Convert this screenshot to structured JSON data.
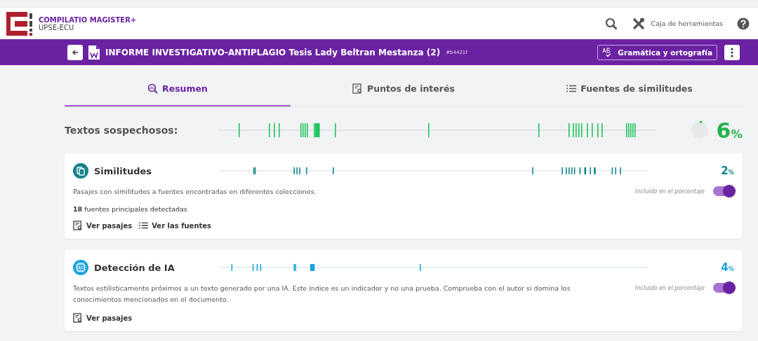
{
  "brand": {
    "name": "COMPILATIO MAGISTER+",
    "org": "UPSE-ECU"
  },
  "toolbar": {
    "tools_label": "Caja de herramientas"
  },
  "document": {
    "title": "INFORME INVESTIGATIVO-ANTIPLAGIO Tesis Lady Beltran Mestanza (2)",
    "id": "#b4421f",
    "grammar_button": "Gramática y ortografía"
  },
  "tabs": [
    {
      "label": "Resumen",
      "kind": "summary",
      "selected": true
    },
    {
      "label": "Puntos de interés",
      "kind": "points",
      "selected": false
    },
    {
      "label": "Fuentes de similitudes",
      "kind": "sources",
      "selected": false
    }
  ],
  "suspicious": {
    "label": "Textos sospechosos:",
    "percent": "6",
    "unit": "%"
  },
  "cards": [
    {
      "kind": "similarity",
      "title": "Similitudes",
      "color": "#12858a",
      "percent": "2",
      "unit": "%",
      "description": "Pasajes con similitudes a fuentes encontradas en diferentes colecciones.",
      "included_label": "Incluido en el porcentaje",
      "included": true,
      "sources_count": "18",
      "sources_text": "fuentes principales detectadas",
      "links": [
        {
          "label": "Ver pasajes",
          "kind": "passages"
        },
        {
          "label": "Ver las fuentes",
          "kind": "sources"
        }
      ]
    },
    {
      "kind": "ai",
      "title": "Detección de IA",
      "color": "#1aa3dd",
      "percent": "4",
      "unit": "%",
      "description": "Textos estilísticamente próximos a un texto generado por una IA. Este índice es un indicador y no una prueba. Comprueba con el autor si domina los conocimientos mencionados en el documento.",
      "included_label": "Incluido en el porcentaje",
      "included": true,
      "links": [
        {
          "label": "Ver pasajes",
          "kind": "passages"
        }
      ]
    }
  ]
}
